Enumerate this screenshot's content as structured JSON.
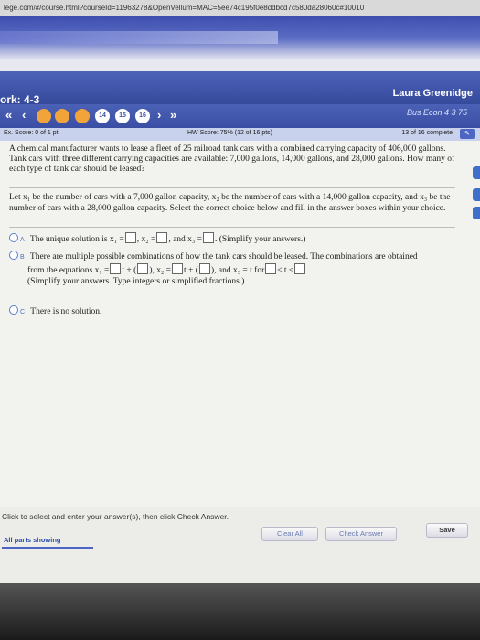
{
  "browser": {
    "url": "lege.com/#/course.html?courseId=11963278&OpenVellum=MAC=5ee74c195f0e8ddbcd7c580da28060c#10010"
  },
  "header": {
    "hw_title": "ork:  4-3",
    "user_name": "Laura Greenidge"
  },
  "toolbar": {
    "first_icon": "«",
    "prev_icon": "‹",
    "next_icon": "›",
    "last_icon": "»",
    "questions": [
      "14",
      "15",
      "16"
    ],
    "course": "Bus Econ 4 3 75"
  },
  "score": {
    "ex_score": "Ex. Score: 0 of 1 pt",
    "hw_score": "HW Score: 75% (12 of 16 pts)",
    "completion": "13 of 16 complete"
  },
  "problem": {
    "text": "A chemical manufacturer wants to lease a fleet of 25 railroad tank cars with a combined carrying capacity of 406,000 gallons. Tank cars with three different carrying capacities are available: 7,000 gallons, 14,000 gallons, and 28,000 gallons. How many of each type of tank car should be leased?"
  },
  "question": {
    "text": "Let x₁ be the number of cars with a 7,000 gallon capacity, x₂ be the number of cars with a 14,000 gallon capacity, and x₃ be the number of cars with a 28,000 gallon capacity. Select the correct choice below and fill in the answer boxes within your choice."
  },
  "options": {
    "a": {
      "letter": "A",
      "t1": "The unique solution is x₁ =",
      "t2": ", x₂ =",
      "t3": ", and x₃ =",
      "t4": ". (Simplify your answers.)"
    },
    "b": {
      "letter": "B",
      "line1": "There are multiple possible combinations of how the tank cars should be leased. The combinations are obtained",
      "t1": "from the equations x₁ =",
      "t2": "t + (",
      "t3": "), x₂ =",
      "t4": "t + (",
      "t5": "), and x₃ = t for",
      "t6": "≤ t ≤",
      "line3": "(Simplify your answers. Type integers or simplified fractions.)"
    },
    "c": {
      "letter": "C",
      "text": "There is no solution."
    }
  },
  "bottom": {
    "instruction": "Click to select and enter your answer(s), then click Check Answer.",
    "parts": "All parts showing",
    "clear_all": "Clear All",
    "check_answer": "Check Answer",
    "save": "Save"
  }
}
